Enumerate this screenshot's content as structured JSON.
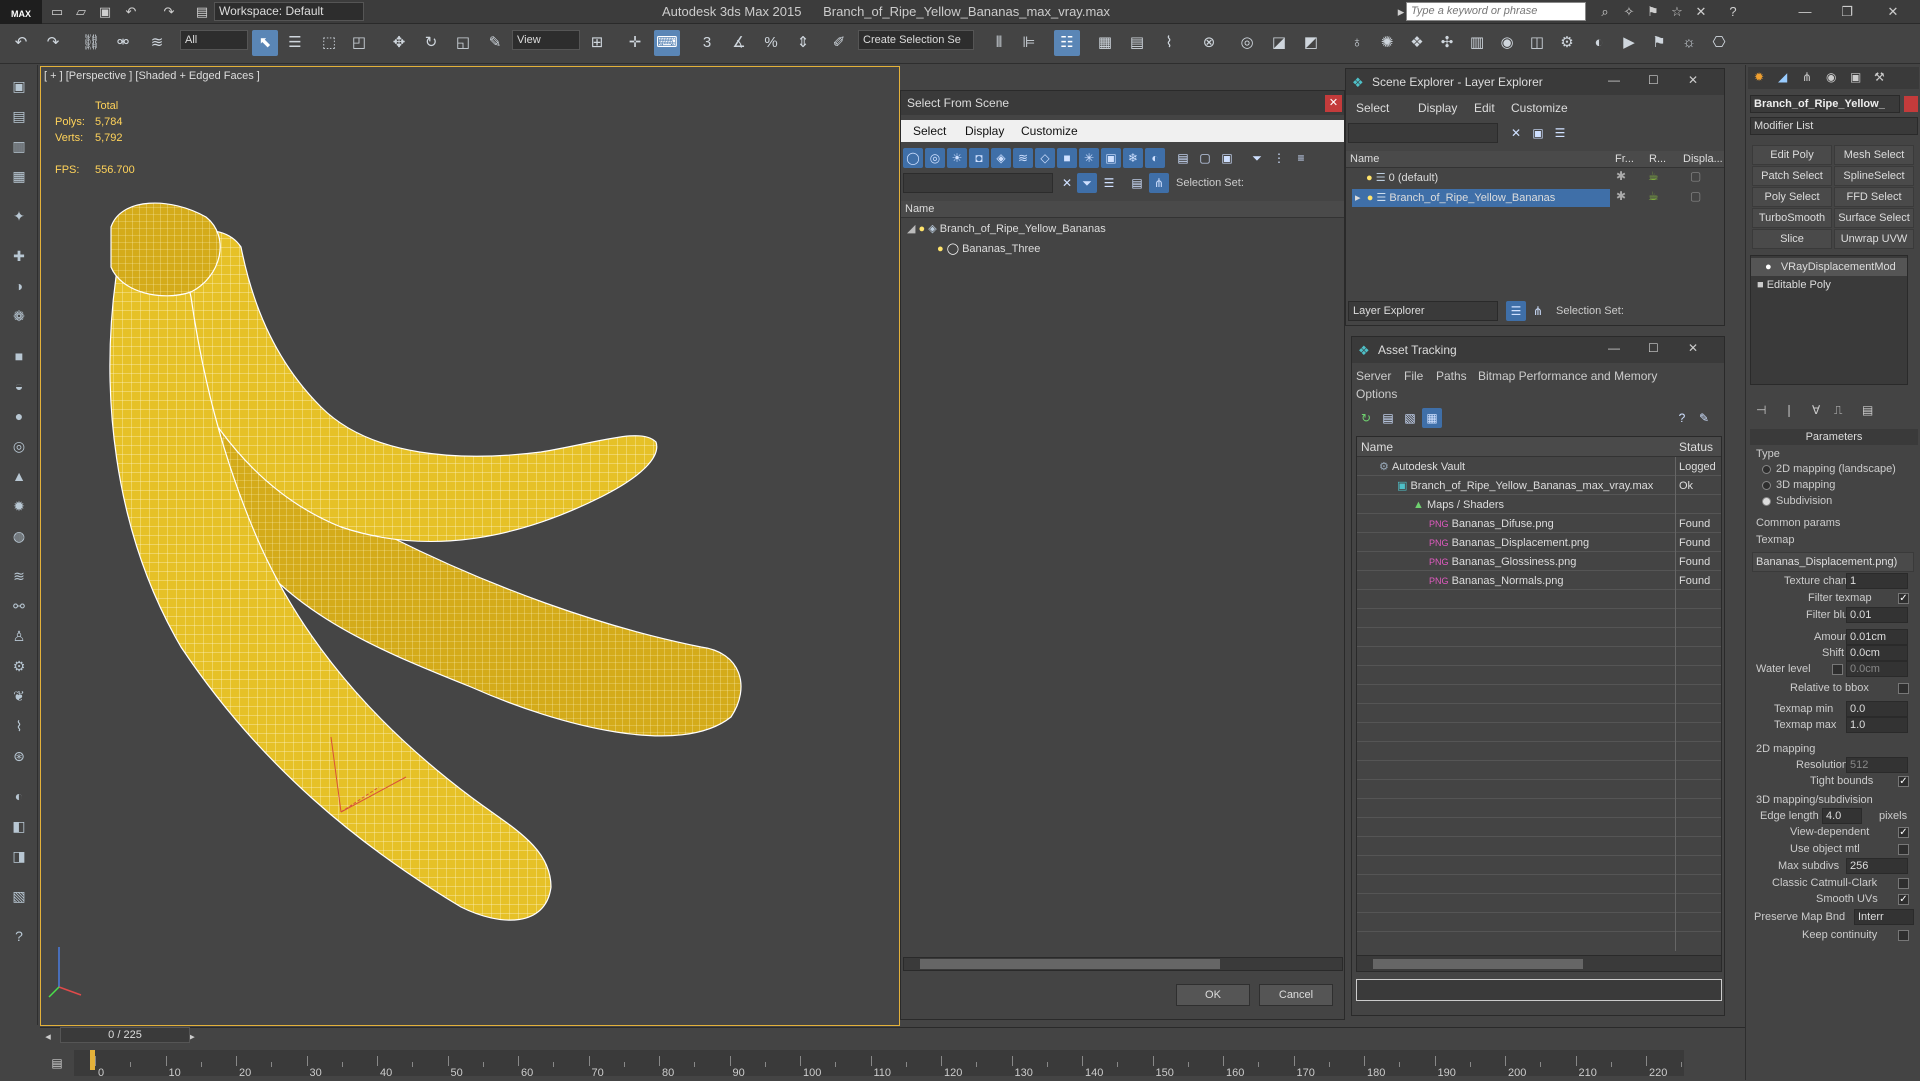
{
  "window": {
    "app_title": "Autodesk 3ds Max  2015",
    "file_title": "Branch_of_Ripe_Yellow_Bananas_max_vray.max",
    "workspace": "Workspace: Default",
    "search_placeholder": "Type a keyword or phrase",
    "logo": "MAX"
  },
  "toolbar": {
    "filter": "All",
    "view": "View",
    "create_selection_set": "Create Selection Se"
  },
  "viewport": {
    "label": "[ + ] [Perspective ] [Shaded + Edged Faces ]",
    "stats": {
      "total_label": "Total",
      "polys_label": "Polys:",
      "polys": "5,784",
      "verts_label": "Verts:",
      "verts": "5,792",
      "fps_label": "FPS:",
      "fps": "556.700"
    }
  },
  "select_from_scene": {
    "title": "Select From Scene",
    "menu": [
      "Select",
      "Display",
      "Customize"
    ],
    "selection_set_label": "Selection Set:",
    "column_name": "Name",
    "tree": [
      {
        "name": "Branch_of_Ripe_Yellow_Bananas"
      },
      {
        "name": "Bananas_Three"
      }
    ],
    "ok": "OK",
    "cancel": "Cancel"
  },
  "scene_explorer": {
    "title": "Scene Explorer - Layer Explorer",
    "menu": [
      "Select",
      "Display",
      "Edit",
      "Customize"
    ],
    "columns": [
      "Name",
      "Fr...",
      "R...",
      "Displa..."
    ],
    "rows": [
      "0 (default)",
      "Branch_of_Ripe_Yellow_Bananas"
    ],
    "footer_dropdown": "Layer Explorer",
    "selection_set_label": "Selection Set:"
  },
  "asset_tracking": {
    "title": "Asset Tracking",
    "menu": [
      "Server",
      "File",
      "Paths",
      "Bitmap Performance and Memory",
      "Options"
    ],
    "columns": [
      "Name",
      "Status"
    ],
    "rows": [
      {
        "name": "Autodesk Vault",
        "status": "Logged"
      },
      {
        "name": "Branch_of_Ripe_Yellow_Bananas_max_vray.max",
        "status": "Ok"
      },
      {
        "name": "Maps / Shaders",
        "status": ""
      },
      {
        "name": "Bananas_Difuse.png",
        "status": "Found"
      },
      {
        "name": "Bananas_Displacement.png",
        "status": "Found"
      },
      {
        "name": "Bananas_Glossiness.png",
        "status": "Found"
      },
      {
        "name": "Bananas_Normals.png",
        "status": "Found"
      }
    ]
  },
  "command_panel": {
    "object_name": "Branch_of_Ripe_Yellow_",
    "modifier_list": "Modifier List",
    "buttons": [
      "Edit Poly",
      "Mesh Select",
      "Patch Select",
      "SplineSelect",
      "Poly Select",
      "FFD Select",
      "TurboSmooth",
      "Surface Select",
      "Slice",
      "Unwrap UVW"
    ],
    "stack": [
      "VRayDisplacementMod",
      "Editable Poly"
    ],
    "parameters_title": "Parameters",
    "type_label": "Type",
    "type_options": [
      "2D mapping (landscape)",
      "3D mapping",
      "Subdivision"
    ],
    "common_params": "Common params",
    "texmap_label": "Texmap",
    "texmap_value": "Bananas_Displacement.png)",
    "texture_chan_label": "Texture chan",
    "texture_chan": "1",
    "filter_texmap": "Filter texmap",
    "filter_blur_label": "Filter blur",
    "filter_blur": "0.01",
    "amount_label": "Amount",
    "amount": "0.01cm",
    "shift_label": "Shift",
    "shift": "0.0cm",
    "water_level_label": "Water level",
    "water_level": "0.0cm",
    "relative_to_bbox": "Relative to bbox",
    "texmap_min_label": "Texmap min",
    "texmap_min": "0.0",
    "texmap_max_label": "Texmap max",
    "texmap_max": "1.0",
    "mapping2d": "2D mapping",
    "resolution_label": "Resolution",
    "resolution": "512",
    "tight_bounds": "Tight bounds",
    "mapping3d": "3D mapping/subdivision",
    "edge_length_label": "Edge length",
    "edge_length": "4.0",
    "pixels": "pixels",
    "view_dependent": "View-dependent",
    "use_object_mtl": "Use object mtl",
    "max_subdivs_label": "Max subdivs",
    "max_subdivs": "256",
    "classic_catmull": "Classic Catmull-Clark",
    "smooth_uvs": "Smooth UVs",
    "preserve_map_bnd": "Preserve Map Bnd",
    "preserve_value": "Interr",
    "keep_continuity": "Keep continuity"
  },
  "timeline": {
    "frame": "0 / 225",
    "ticks": [
      "0",
      "10",
      "20",
      "30",
      "40",
      "50",
      "60",
      "70",
      "80",
      "90",
      "100",
      "110",
      "120",
      "130",
      "140",
      "150",
      "160",
      "170",
      "180",
      "190",
      "200",
      "210",
      "220"
    ]
  },
  "colors": {
    "banana": "#e6c127",
    "viewport_border": "#e3b13a",
    "accent": "#3f6fa8"
  }
}
